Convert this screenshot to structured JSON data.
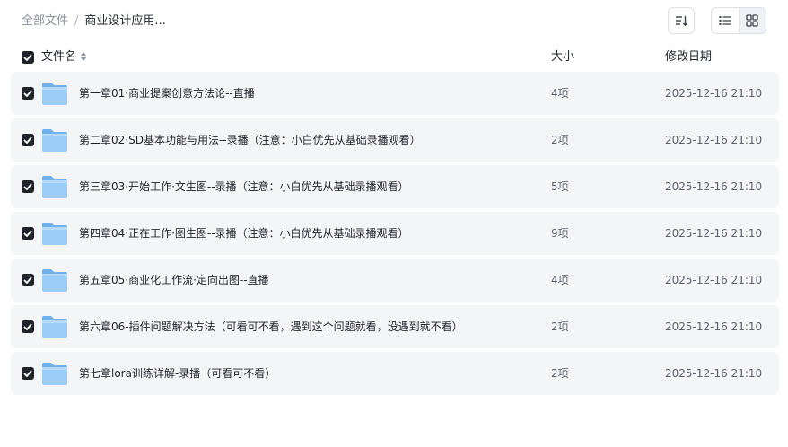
{
  "breadcrumb": {
    "root": "全部文件",
    "separator": "/",
    "current": "商业设计应用..."
  },
  "toolbar": {
    "sort_icon": "sort-icon",
    "list_view_icon": "list-icon",
    "grid_view_icon": "grid-icon",
    "active_view": "list"
  },
  "header": {
    "name": "文件名",
    "size": "大小",
    "date": "修改日期"
  },
  "colors": {
    "checkbox": "#1f2329",
    "row_background": "#f4f5f7",
    "folder": "#8cc4f5"
  },
  "files": [
    {
      "name": "第一章01·商业提案创意方法论--直播",
      "size": "4项",
      "date": "2025-12-16 21:10",
      "checked": true
    },
    {
      "name": "第二章02·SD基本功能与用法--录播（注意：小白优先从基础录播观看）",
      "size": "2项",
      "date": "2025-12-16 21:10",
      "checked": true
    },
    {
      "name": "第三章03·开始工作·文生图--录播（注意：小白优先从基础录播观看）",
      "size": "5项",
      "date": "2025-12-16 21:10",
      "checked": true
    },
    {
      "name": "第四章04·正在工作·图生图--录播（注意：小白优先从基础录播观看）",
      "size": "9项",
      "date": "2025-12-16 21:10",
      "checked": true
    },
    {
      "name": "第五章05·商业化工作流·定向出图--直播",
      "size": "4项",
      "date": "2025-12-16 21:10",
      "checked": true
    },
    {
      "name": "第六章06-插件问题解决方法（可看可不看，遇到这个问题就看，没遇到就不看）",
      "size": "2项",
      "date": "2025-12-16 21:10",
      "checked": true
    },
    {
      "name": "第七章lora训练详解-录播（可看可不看）",
      "size": "2项",
      "date": "2025-12-16 21:10",
      "checked": true
    }
  ]
}
